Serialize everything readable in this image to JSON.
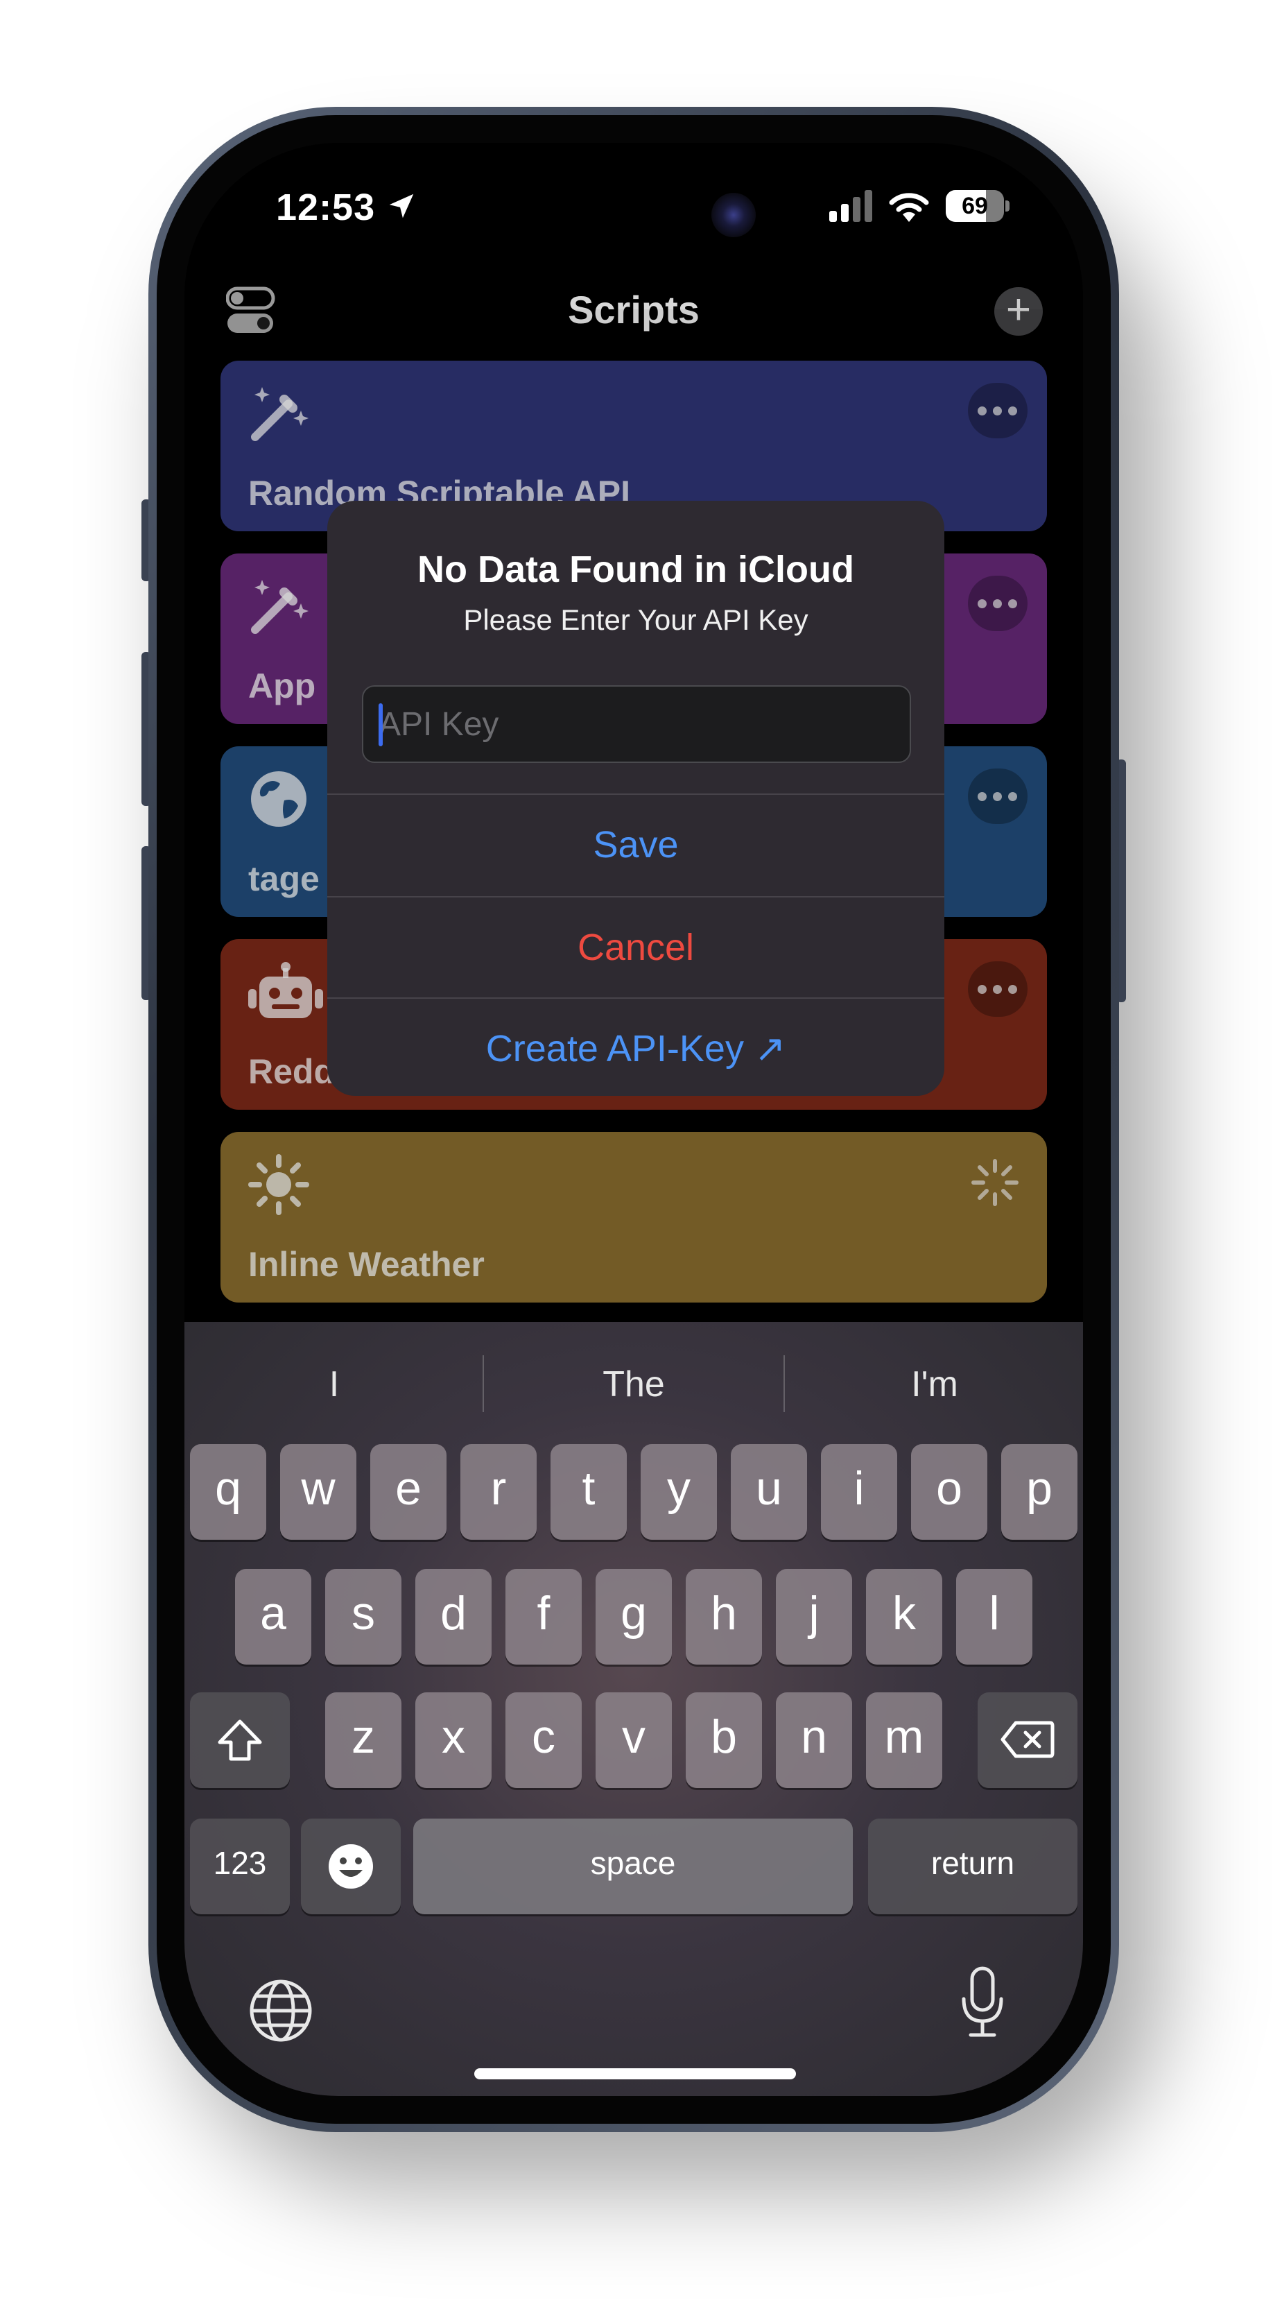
{
  "status_bar": {
    "time": "12:53",
    "battery": "69",
    "battery_level": 0.69
  },
  "nav": {
    "title": "Scripts"
  },
  "cards": [
    {
      "title": "Random Scriptable API",
      "icon": "magic-wand-icon",
      "color": "#2a2f69"
    },
    {
      "title": "App",
      "icon": "magic-wand-icon",
      "color": "#5b246b"
    },
    {
      "title": "tage",
      "icon": "globe-icon",
      "color": "#1e446e"
    },
    {
      "title": "Redd",
      "icon": "robot-icon",
      "color": "#6e2416"
    },
    {
      "title": "Inline Weather",
      "icon": "sun-icon",
      "color": "#7a6029"
    }
  ],
  "alert": {
    "title": "No Data Found in iCloud",
    "message": "Please Enter Your API Key",
    "field_placeholder": "API Key",
    "save": "Save",
    "cancel": "Cancel",
    "create_link": "Create API-Key ↗"
  },
  "keyboard": {
    "suggestions": [
      "I",
      "The",
      "I'm"
    ],
    "row1": [
      "q",
      "w",
      "e",
      "r",
      "t",
      "y",
      "u",
      "i",
      "o",
      "p"
    ],
    "row2": [
      "a",
      "s",
      "d",
      "f",
      "g",
      "h",
      "j",
      "k",
      "l"
    ],
    "row3": [
      "z",
      "x",
      "c",
      "v",
      "b",
      "n",
      "m"
    ],
    "numbers": "123",
    "space": "space",
    "return": "return"
  }
}
